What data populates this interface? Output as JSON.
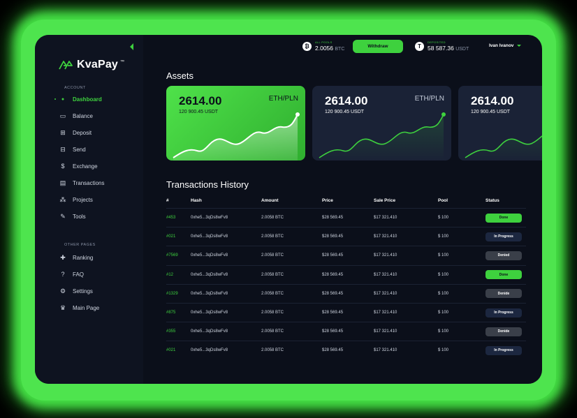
{
  "brand": {
    "name": "KvaPay",
    "tm": "™"
  },
  "sidebar": {
    "account_label": "ACCOUNT",
    "account_items": [
      {
        "label": "Dashboard",
        "icon": "user-icon",
        "active": true
      },
      {
        "label": "Balance",
        "icon": "wallet-icon"
      },
      {
        "label": "Deposit",
        "icon": "deposit-icon"
      },
      {
        "label": "Send",
        "icon": "send-icon"
      },
      {
        "label": "Exchange",
        "icon": "exchange-icon"
      },
      {
        "label": "Transactions",
        "icon": "transactions-icon"
      },
      {
        "label": "Projects",
        "icon": "projects-icon"
      },
      {
        "label": "Tools",
        "icon": "tools-icon"
      }
    ],
    "other_label": "OTHER PAGES",
    "other_items": [
      {
        "label": "Ranking",
        "icon": "ranking-icon"
      },
      {
        "label": "FAQ",
        "icon": "faq-icon"
      },
      {
        "label": "Settings",
        "icon": "settings-icon"
      },
      {
        "label": "Main Page",
        "icon": "crown-icon"
      }
    ]
  },
  "topbar": {
    "all_pools": {
      "label": "ALL POOLS",
      "value": "2.0056",
      "unit": "BTC",
      "coin": "₿"
    },
    "withdraw_label": "Withdraw",
    "deposited": {
      "label": "DEPOSITED",
      "value": "58 587.36",
      "unit": "USDT",
      "coin": "T"
    },
    "user_name": "Ivan Ivanov"
  },
  "assets": {
    "title": "Assets",
    "cards": [
      {
        "amount": "2614.00",
        "sub": "120 900.45 USDT",
        "pair": "ETH/PLN"
      },
      {
        "amount": "2614.00",
        "sub": "120 900.45 USDT",
        "pair": "ETH/PLN"
      },
      {
        "amount": "2614.00",
        "sub": "120 900.45 USDT",
        "pair": ""
      }
    ]
  },
  "transactions": {
    "title": "Transactions History",
    "columns": [
      "#",
      "Hash",
      "Amount",
      "Price",
      "Sale Price",
      "Pool",
      "Status"
    ],
    "rows": [
      [
        "#453",
        "0xhe5...3qDs8wFv8",
        "2.0058 BTC",
        "$28 569.45",
        "$17 321.410",
        "$ 100",
        "Done"
      ],
      [
        "#021",
        "0xhe5...3qDs8wFv8",
        "2.0058 BTC",
        "$28 569.45",
        "$17 321.410",
        "$ 100",
        "In Progress"
      ],
      [
        "#7569",
        "0xhe5...3qDs8wFv8",
        "2.0058 BTC",
        "$28 569.45",
        "$17 321.410",
        "$ 100",
        "Denied"
      ],
      [
        "#12",
        "0xhe5...3qDs8wFv8",
        "2.0058 BTC",
        "$28 569.45",
        "$17 321.410",
        "$ 100",
        "Done"
      ],
      [
        "#1329",
        "0xhe5...3qDs8wFv8",
        "2.0058 BTC",
        "$28 569.45",
        "$17 321.410",
        "$ 100",
        "Denide"
      ],
      [
        "#875",
        "0xhe5...3qDs8wFv8",
        "2.0058 BTC",
        "$28 569.45",
        "$17 321.410",
        "$ 100",
        "In Progress"
      ],
      [
        "#355",
        "0xhe5...3qDs8wFv8",
        "2.0058 BTC",
        "$28 569.45",
        "$17 321.410",
        "$ 100",
        "Denide"
      ],
      [
        "#021",
        "0xhe5...3qDs8wFv8",
        "2.0058 BTC",
        "$28 569.45",
        "$17 321.410",
        "$ 100",
        "In Progress"
      ]
    ]
  },
  "colors": {
    "accent": "#3ed13e",
    "background": "#0b0f1a",
    "sidebar": "#0e1320",
    "card_dark": "#1a2236"
  }
}
